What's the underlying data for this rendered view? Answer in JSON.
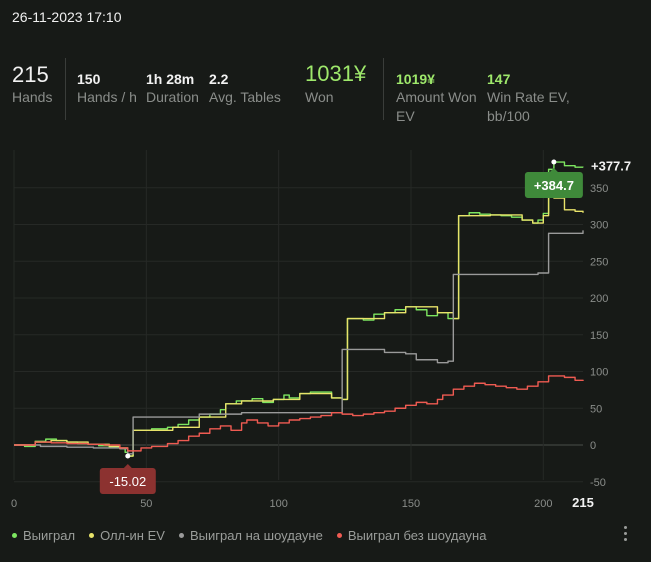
{
  "datetime": "26-11-2023 17:10",
  "stats": {
    "hands": {
      "value": "215",
      "label": "Hands"
    },
    "hands_per_hour": {
      "value": "150",
      "label": "Hands / h"
    },
    "duration": {
      "value": "1h 28m",
      "label": "Duration"
    },
    "avg_tables": {
      "value": "2.2",
      "label": "Avg. Tables"
    },
    "won": {
      "value": "1031¥",
      "label": "Won"
    },
    "amount_won_ev": {
      "value": "1019¥",
      "label_line1": "Amount Won",
      "label_line2": "EV"
    },
    "win_rate_ev": {
      "value": "147",
      "label_line1": "Win Rate EV,",
      "label_line2": "bb/100"
    }
  },
  "chart_data": {
    "type": "line",
    "xlim": [
      0,
      215
    ],
    "ylim": [
      -60,
      400
    ],
    "x_ticks": [
      "0",
      "50",
      "100",
      "150",
      "200",
      "215"
    ],
    "y_ticks": [
      "-50",
      "0",
      "50",
      "100",
      "150",
      "200",
      "250",
      "300",
      "350"
    ],
    "grid": true,
    "legend_position": "bottom-left",
    "annotations": {
      "max_label": "+384.7",
      "min_label": "-15.02",
      "end_label": "+377.7"
    },
    "colors": {
      "won": "#7de660",
      "allin_ev": "#e8e36a",
      "showdown": "#9a9a9a",
      "non_showdown": "#ef5b52"
    },
    "series": [
      {
        "name": "Выиграл",
        "color": "#7de660",
        "points": [
          [
            0,
            0
          ],
          [
            4,
            -2
          ],
          [
            8,
            5
          ],
          [
            12,
            8
          ],
          [
            16,
            6
          ],
          [
            20,
            4
          ],
          [
            24,
            2
          ],
          [
            28,
            1
          ],
          [
            32,
            -1
          ],
          [
            36,
            -3
          ],
          [
            40,
            -5
          ],
          [
            42,
            -10
          ],
          [
            43,
            -15
          ],
          [
            45,
            20
          ],
          [
            52,
            22
          ],
          [
            58,
            24
          ],
          [
            62,
            28
          ],
          [
            66,
            34
          ],
          [
            70,
            38
          ],
          [
            74,
            42
          ],
          [
            78,
            48
          ],
          [
            80,
            56
          ],
          [
            84,
            60
          ],
          [
            86,
            60
          ],
          [
            90,
            63
          ],
          [
            94,
            58
          ],
          [
            98,
            62
          ],
          [
            102,
            68
          ],
          [
            104,
            64
          ],
          [
            108,
            70
          ],
          [
            112,
            72
          ],
          [
            116,
            72
          ],
          [
            120,
            64
          ],
          [
            124,
            62
          ],
          [
            126,
            172
          ],
          [
            132,
            170
          ],
          [
            136,
            178
          ],
          [
            140,
            180
          ],
          [
            144,
            184
          ],
          [
            148,
            188
          ],
          [
            152,
            184
          ],
          [
            156,
            176
          ],
          [
            160,
            180
          ],
          [
            164,
            172
          ],
          [
            166,
            172
          ],
          [
            168,
            312
          ],
          [
            172,
            316
          ],
          [
            176,
            314
          ],
          [
            180,
            313
          ],
          [
            184,
            312
          ],
          [
            188,
            310
          ],
          [
            192,
            306
          ],
          [
            196,
            302
          ],
          [
            198,
            306
          ],
          [
            200,
            315
          ],
          [
            202,
            375
          ],
          [
            204,
            385
          ],
          [
            208,
            380
          ],
          [
            212,
            378
          ],
          [
            215,
            377.7
          ]
        ]
      },
      {
        "name": "Олл-ин EV",
        "color": "#e8e36a",
        "points": [
          [
            0,
            0
          ],
          [
            8,
            4
          ],
          [
            14,
            6
          ],
          [
            20,
            4
          ],
          [
            28,
            1
          ],
          [
            36,
            -2
          ],
          [
            40,
            -4
          ],
          [
            43,
            -15
          ],
          [
            45,
            20
          ],
          [
            60,
            24
          ],
          [
            70,
            38
          ],
          [
            80,
            56
          ],
          [
            86,
            60
          ],
          [
            98,
            62
          ],
          [
            108,
            70
          ],
          [
            120,
            64
          ],
          [
            124,
            62
          ],
          [
            126,
            172
          ],
          [
            140,
            180
          ],
          [
            148,
            188
          ],
          [
            160,
            180
          ],
          [
            166,
            172
          ],
          [
            168,
            312
          ],
          [
            180,
            313
          ],
          [
            192,
            306
          ],
          [
            196,
            302
          ],
          [
            200,
            312
          ],
          [
            202,
            345
          ],
          [
            204,
            336
          ],
          [
            208,
            320
          ],
          [
            212,
            318
          ],
          [
            215,
            316
          ]
        ]
      },
      {
        "name": "Выиграл на шоудауне",
        "color": "#9a9a9a",
        "points": [
          [
            0,
            0
          ],
          [
            10,
            -2
          ],
          [
            20,
            -3
          ],
          [
            30,
            -4
          ],
          [
            40,
            -5
          ],
          [
            43,
            -12
          ],
          [
            45,
            38
          ],
          [
            60,
            38
          ],
          [
            70,
            42
          ],
          [
            86,
            44
          ],
          [
            100,
            44
          ],
          [
            110,
            44
          ],
          [
            122,
            44
          ],
          [
            124,
            130
          ],
          [
            140,
            126
          ],
          [
            148,
            124
          ],
          [
            152,
            116
          ],
          [
            160,
            112
          ],
          [
            164,
            114
          ],
          [
            166,
            232
          ],
          [
            190,
            232
          ],
          [
            198,
            234
          ],
          [
            202,
            288
          ],
          [
            215,
            292
          ]
        ]
      },
      {
        "name": "Выиграл без шоудауна",
        "color": "#ef5b52",
        "points": [
          [
            0,
            0
          ],
          [
            8,
            4
          ],
          [
            14,
            3
          ],
          [
            20,
            2
          ],
          [
            28,
            1
          ],
          [
            34,
            0
          ],
          [
            40,
            -4
          ],
          [
            43,
            -8
          ],
          [
            48,
            -4
          ],
          [
            52,
            -2
          ],
          [
            58,
            2
          ],
          [
            62,
            6
          ],
          [
            66,
            12
          ],
          [
            70,
            16
          ],
          [
            74,
            22
          ],
          [
            78,
            26
          ],
          [
            82,
            20
          ],
          [
            86,
            30
          ],
          [
            88,
            34
          ],
          [
            92,
            30
          ],
          [
            96,
            26
          ],
          [
            100,
            30
          ],
          [
            104,
            34
          ],
          [
            108,
            36
          ],
          [
            112,
            38
          ],
          [
            116,
            40
          ],
          [
            120,
            44
          ],
          [
            124,
            42
          ],
          [
            128,
            40
          ],
          [
            132,
            42
          ],
          [
            136,
            44
          ],
          [
            140,
            46
          ],
          [
            144,
            50
          ],
          [
            148,
            54
          ],
          [
            152,
            58
          ],
          [
            156,
            56
          ],
          [
            160,
            62
          ],
          [
            162,
            68
          ],
          [
            166,
            76
          ],
          [
            170,
            80
          ],
          [
            174,
            84
          ],
          [
            178,
            82
          ],
          [
            182,
            80
          ],
          [
            186,
            78
          ],
          [
            190,
            76
          ],
          [
            194,
            80
          ],
          [
            198,
            86
          ],
          [
            202,
            94
          ],
          [
            208,
            92
          ],
          [
            212,
            88
          ],
          [
            215,
            87
          ]
        ]
      }
    ]
  },
  "legend": [
    {
      "name": "Выиграл",
      "color": "#7de660"
    },
    {
      "name": "Олл-ин EV",
      "color": "#e8e36a"
    },
    {
      "name": "Выиграл на шоудауне",
      "color": "#9a9a9a"
    },
    {
      "name": "Выиграл без шоудауна",
      "color": "#ef5b52"
    }
  ],
  "menu_icon": "kebab-menu-icon"
}
